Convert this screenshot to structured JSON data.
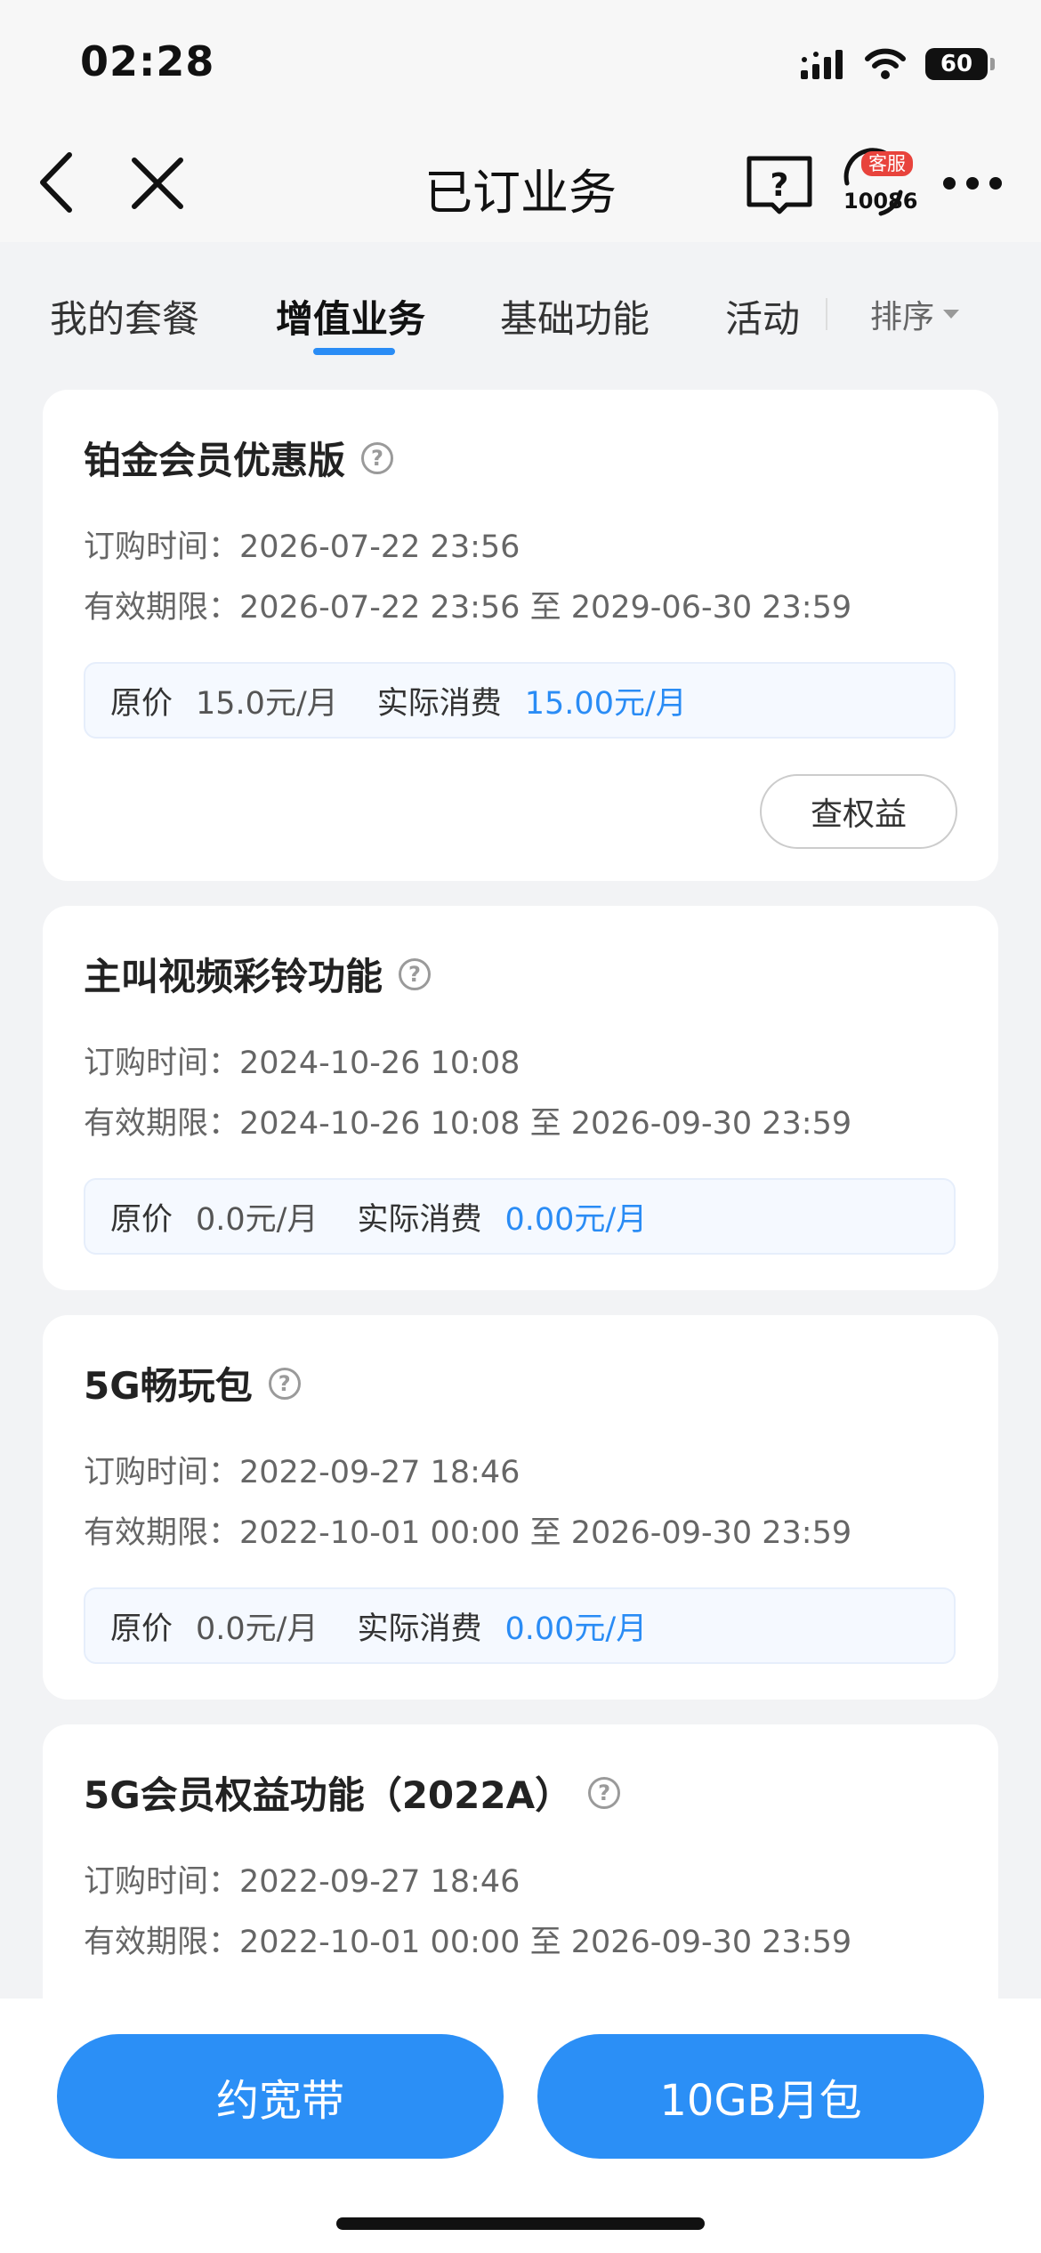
{
  "status": {
    "time": "02:28",
    "battery": "60"
  },
  "nav": {
    "title": "已订业务",
    "cs_badge": "客服",
    "cs_number": "10086"
  },
  "tabs": [
    {
      "label": "我的套餐",
      "active": false
    },
    {
      "label": "增值业务",
      "active": true
    },
    {
      "label": "基础功能",
      "active": false
    },
    {
      "label": "活动",
      "active": false
    }
  ],
  "sort_label": "排序",
  "labels": {
    "order_time": "订购时间：",
    "valid_period": "有效期限：",
    "original_price": "原价",
    "actual_cost": "实际消费",
    "to": "至",
    "benefit_button": "查权益"
  },
  "services": [
    {
      "name": "铂金会员优惠版",
      "order_time": "2026-07-22 23:56",
      "valid_from": "2026-07-22 23:56",
      "valid_to": "2029-06-30 23:59",
      "original_price": "15.0元/月",
      "actual_cost": "15.00元/月",
      "has_benefit_button": true
    },
    {
      "name": "主叫视频彩铃功能",
      "order_time": "2024-10-26 10:08",
      "valid_from": "2024-10-26 10:08",
      "valid_to": "2026-09-30 23:59",
      "original_price": "0.0元/月",
      "actual_cost": "0.00元/月",
      "has_benefit_button": false
    },
    {
      "name": "5G畅玩包",
      "order_time": "2022-09-27 18:46",
      "valid_from": "2022-10-01 00:00",
      "valid_to": "2026-09-30 23:59",
      "original_price": "0.0元/月",
      "actual_cost": "0.00元/月",
      "has_benefit_button": false
    },
    {
      "name": "5G会员权益功能（2022A）",
      "order_time": "2022-09-27 18:46",
      "valid_from": "2022-10-01 00:00",
      "valid_to": "2026-09-30 23:59",
      "has_benefit_button": false
    }
  ],
  "bottom_buttons": {
    "left": "约宽带",
    "right": "10GB月包"
  },
  "colors": {
    "accent": "#2a8cf5",
    "button": "#2b8ff6",
    "badge": "#e8433c"
  }
}
